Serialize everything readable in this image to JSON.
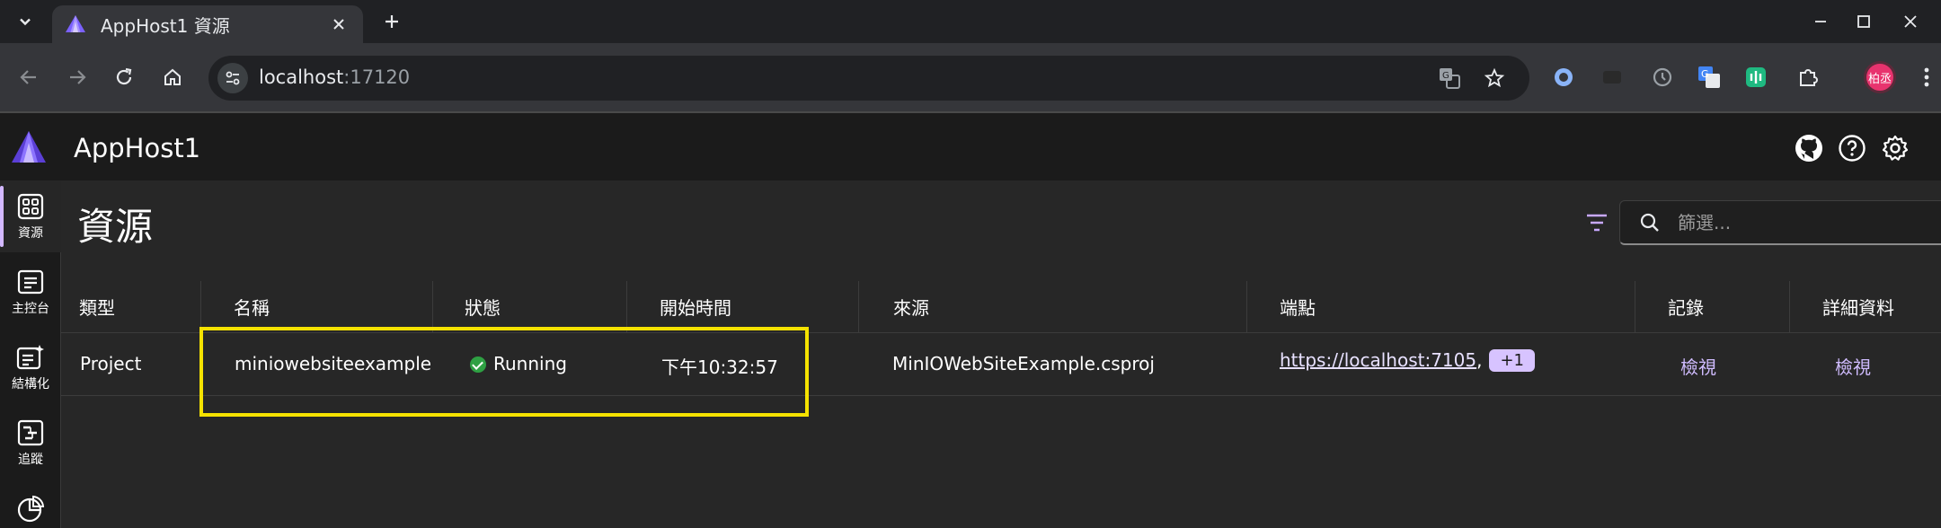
{
  "browser": {
    "tab_title": "AppHost1 資源",
    "url_host": "localhost",
    "url_port": ":17120",
    "profile_initials": "柏丞"
  },
  "app": {
    "title": "AppHost1",
    "brand_color": "#7b61ff"
  },
  "nav": {
    "items": [
      {
        "label": "資源",
        "icon": "resources-icon",
        "active": true
      },
      {
        "label": "主控台",
        "icon": "console-icon",
        "active": false
      },
      {
        "label": "結構化",
        "icon": "structured-logs-icon",
        "active": false
      },
      {
        "label": "追蹤",
        "icon": "traces-icon",
        "active": false
      },
      {
        "label": "",
        "icon": "metrics-icon",
        "active": false
      }
    ]
  },
  "page": {
    "title": "資源",
    "filter_placeholder": "篩選..."
  },
  "grid": {
    "headers": [
      "類型",
      "名稱",
      "狀態",
      "開始時間",
      "來源",
      "端點",
      "記錄",
      "詳細資料"
    ],
    "rows": [
      {
        "type": "Project",
        "name": "miniowebsiteexample",
        "state": "Running",
        "start_time": "下午10:32:57",
        "source": "MinIOWebSiteExample.csproj",
        "endpoint": "https://localhost:7105",
        "endpoint_sep": ",",
        "endpoint_more": "+1",
        "logs": "檢視",
        "details": "檢視"
      }
    ]
  },
  "colors": {
    "accent": "#d0bcff",
    "running": "#2ea043",
    "highlight": "#f5e200"
  }
}
